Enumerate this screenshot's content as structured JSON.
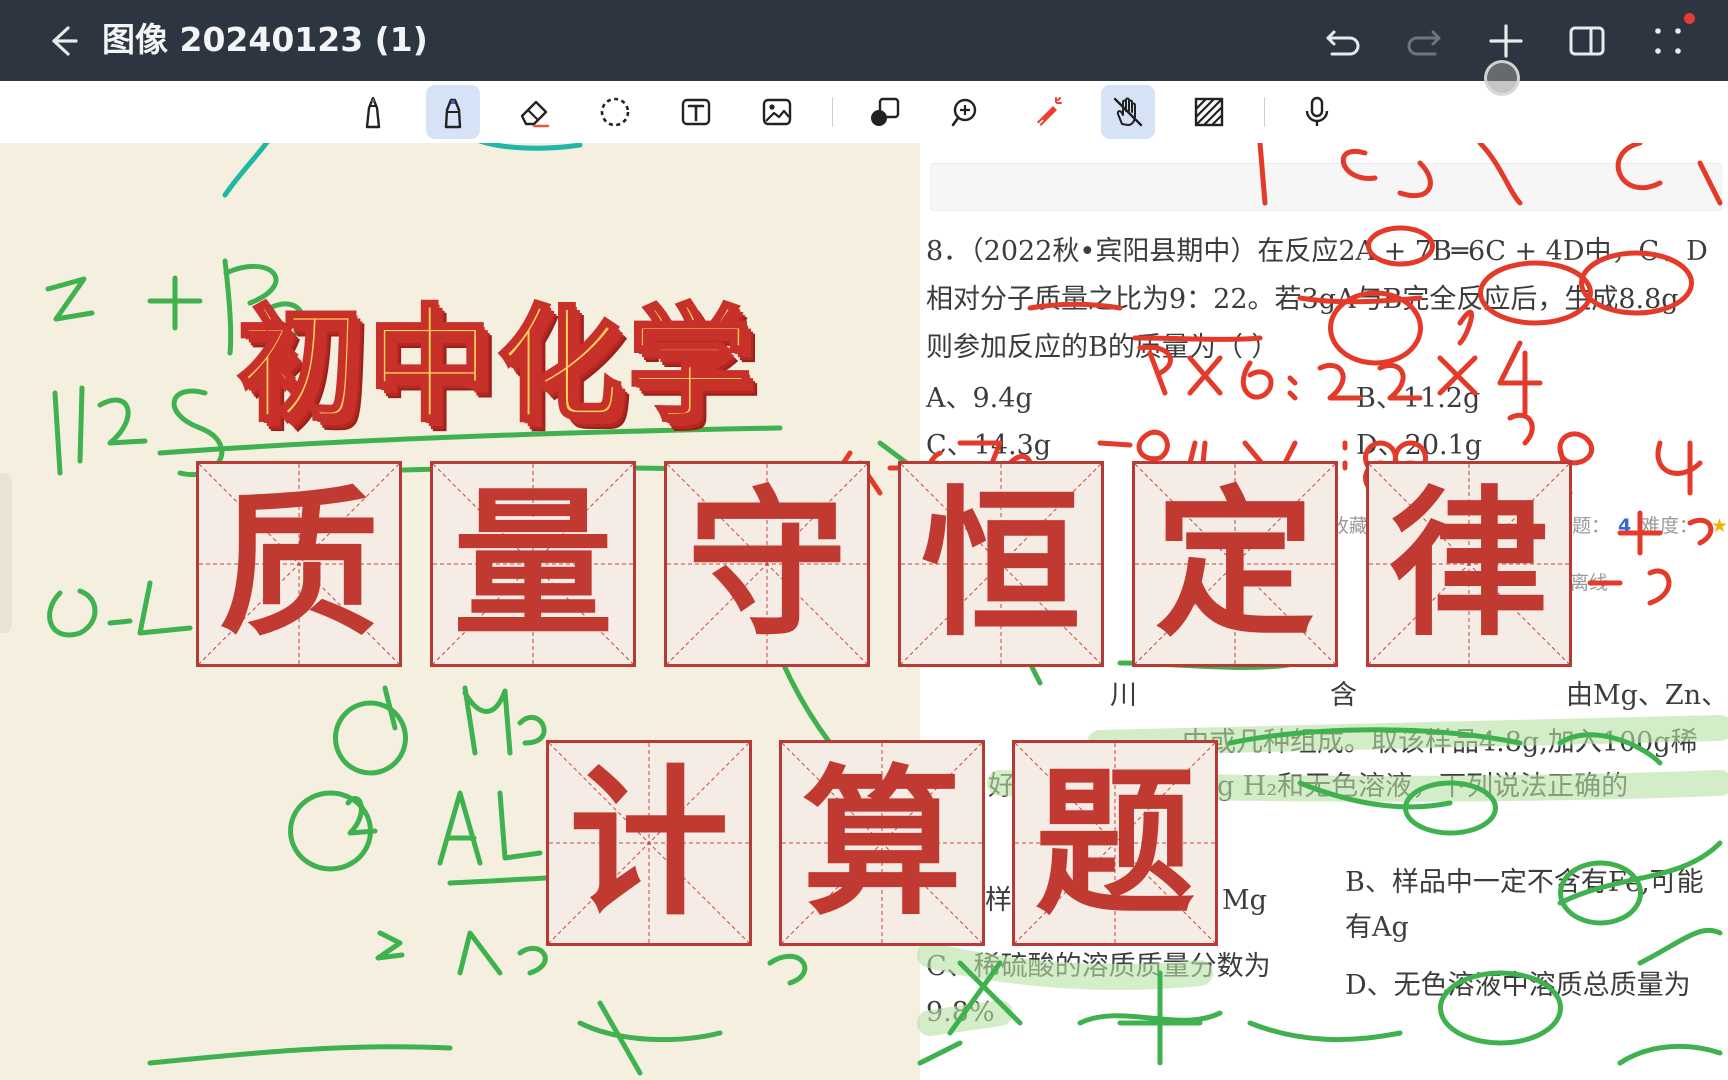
{
  "app": {
    "title": "图像 20240123 (1)",
    "colors": {
      "titlebar_bg": "#2d3540",
      "accent_active": "#d6e2f5",
      "ink_red": "#e33a2a",
      "ink_green": "#3fb24f",
      "ink_teal": "#1fb8a6",
      "tile_red": "#c13a31",
      "subtitle_yellow": "#ffd25a"
    }
  },
  "titlebar": {
    "back_icon": "arrow-left-icon",
    "actions": [
      {
        "name": "undo",
        "icon": "undo-icon"
      },
      {
        "name": "redo",
        "icon": "redo-icon"
      },
      {
        "name": "add",
        "icon": "plus-icon"
      },
      {
        "name": "sidebar",
        "icon": "panel-icon"
      },
      {
        "name": "more",
        "icon": "dots-grid-icon"
      }
    ]
  },
  "toolbar": {
    "tools": [
      {
        "name": "pen",
        "icon": "pen-icon",
        "active": false
      },
      {
        "name": "highlighter",
        "icon": "highlighter-icon",
        "active": true
      },
      {
        "name": "eraser",
        "icon": "eraser-icon",
        "active": false
      },
      {
        "name": "lasso",
        "icon": "lasso-icon",
        "active": false
      },
      {
        "name": "text",
        "icon": "text-box-icon",
        "active": false
      },
      {
        "name": "image",
        "icon": "image-icon",
        "active": false
      },
      {
        "name": "shapes",
        "icon": "shapes-icon",
        "active": false
      },
      {
        "name": "zoom",
        "icon": "zoom-in-icon",
        "active": false
      },
      {
        "name": "laser",
        "icon": "laser-pointer-icon",
        "active": false
      },
      {
        "name": "finger-draw",
        "icon": "hand-off-icon",
        "active": true
      },
      {
        "name": "pattern",
        "icon": "hatch-icon",
        "active": false
      },
      {
        "name": "voice",
        "icon": "microphone-icon",
        "active": false
      }
    ]
  },
  "document": {
    "q8_line1": "8．（2022秋•宾阳县期中）在反应2A + 7B═6C + 4D中，C、D",
    "q8_line2": "相对分子质量之比为9：22。若3gA与B完全反应后，生成8.8g",
    "q8_line3": "则参加反应的B的质量为（ ）",
    "opt_a": "A、9.4g",
    "opt_b": "B、11.2g",
    "opt_c": "C、14.3g",
    "opt_d": "D、20.1g",
    "meta_left": "收藏",
    "meta_count_label": "题：",
    "meta_count": "4",
    "meta_difficulty": "难度：",
    "meta_star": "★",
    "meta_offline": "离线",
    "q9_line1": "川",
    "q9_line1b": "含",
    "q9_line1c": "由Mg、Zn、A",
    "q9_line2": "中或几种组成。取该样品4.8g,加入100g稀",
    "q9_line3a": "好",
    "q9_line3b": "得到0.4g H₂和无色溶液，下列说法正确的",
    "q9_a1": "样",
    "q9_a2": "Mg",
    "q9_b1": "B、样品中一定不含有Fe,可能",
    "q9_b2": "有Ag",
    "q9_c1": "C、稀硫酸的溶质质量分数为",
    "q9_c2": "9.8%",
    "q9_d1": "D、无色溶液中溶质总质量为"
  },
  "overlay": {
    "subtitle": "初中化学",
    "row1": [
      "质",
      "量",
      "守",
      "恒",
      "定",
      "律"
    ],
    "row2": [
      "计",
      "算",
      "题"
    ]
  }
}
